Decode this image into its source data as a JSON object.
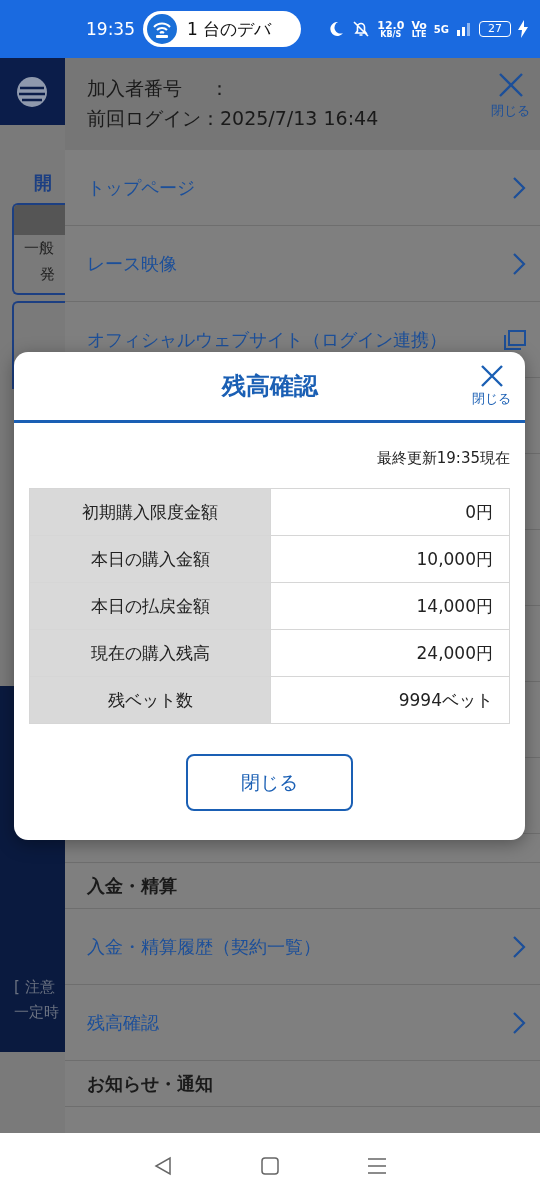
{
  "status_bar": {
    "time": "19:35",
    "hotspot_label": "1 台のデバ",
    "speed": "12.0",
    "speed_unit": "KB/S",
    "volte_top": "Vo",
    "volte_bottom": "LTE",
    "network": "5G",
    "battery": "27"
  },
  "background_page": {
    "section_label": "開",
    "box_line_1": "一般",
    "box_line_2": "発",
    "note_line_1": "[ 注意",
    "note_line_2": "一定時"
  },
  "drawer": {
    "member_label": "加入者番号",
    "member_colon": "：",
    "last_login": "前回ログイン：2025/7/13 16:44",
    "close_label": "閉じる",
    "top_items": [
      {
        "kind": "link",
        "label": "トップページ"
      },
      {
        "kind": "link",
        "label": "レース映像"
      },
      {
        "kind": "external",
        "label": "オフィシャルウェブサイト（ログイン連携）"
      }
    ],
    "bottom_items": [
      {
        "kind": "section",
        "label": "入金・精算"
      },
      {
        "kind": "link",
        "label": "入金・精算履歴（契約一覧）"
      },
      {
        "kind": "link",
        "label": "残高確認"
      },
      {
        "kind": "section",
        "label": "お知らせ・通知"
      }
    ]
  },
  "modal": {
    "title": "残高確認",
    "close_label": "閉じる",
    "updated": "最終更新19:35現在",
    "rows": [
      {
        "label": "初期購入限度金額",
        "value": "0円"
      },
      {
        "label": "本日の購入金額",
        "value": "10,000円"
      },
      {
        "label": "本日の払戻金額",
        "value": "14,000円"
      },
      {
        "label": "現在の購入残高",
        "value": "24,000円"
      },
      {
        "label": "残ベット数",
        "value": "9994ベット"
      }
    ],
    "button": "閉じる"
  }
}
